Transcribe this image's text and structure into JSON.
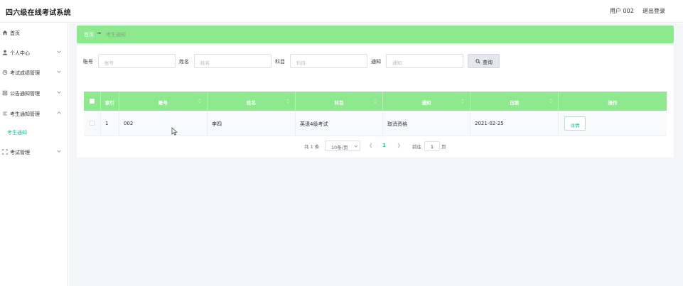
{
  "header": {
    "title": "四六级在线考试系统",
    "user": "用户 002",
    "logout": "退出登录"
  },
  "sidebar": {
    "items": [
      {
        "label": "首页",
        "icon": "home-icon"
      },
      {
        "label": "个人中心",
        "icon": "user-icon"
      },
      {
        "label": "考试成绩管理",
        "icon": "score-icon"
      },
      {
        "label": "公告通知管理",
        "icon": "list-icon"
      },
      {
        "label": "考生通知管理",
        "icon": "notice-icon"
      },
      {
        "label": "考试管理",
        "icon": "exam-icon"
      }
    ],
    "sub_item": "考生通知"
  },
  "breadcrumb": {
    "home": "首页",
    "separator": "→",
    "current": "考生通知"
  },
  "search": {
    "fields": [
      {
        "label": "账号",
        "placeholder": "账号"
      },
      {
        "label": "姓名",
        "placeholder": "姓名"
      },
      {
        "label": "科目",
        "placeholder": "科目"
      },
      {
        "label": "通知",
        "placeholder": "通知"
      }
    ],
    "button": "查询"
  },
  "table": {
    "headers": [
      "索引",
      "账号",
      "姓名",
      "科目",
      "通知",
      "日期",
      "操作"
    ],
    "rows": [
      {
        "index": "1",
        "account": "002",
        "name": "李四",
        "subject": "英语4级考试",
        "notice": "取消资格",
        "date": "2021-02-25",
        "action": "详情"
      }
    ]
  },
  "pagination": {
    "total": "共 1 条",
    "page_size": "10条/页",
    "current_page": "1",
    "goto_label": "前往",
    "goto_value": "1",
    "page_unit": "页"
  },
  "colors": {
    "accent": "#8ee88e",
    "link": "#1abc9c"
  }
}
